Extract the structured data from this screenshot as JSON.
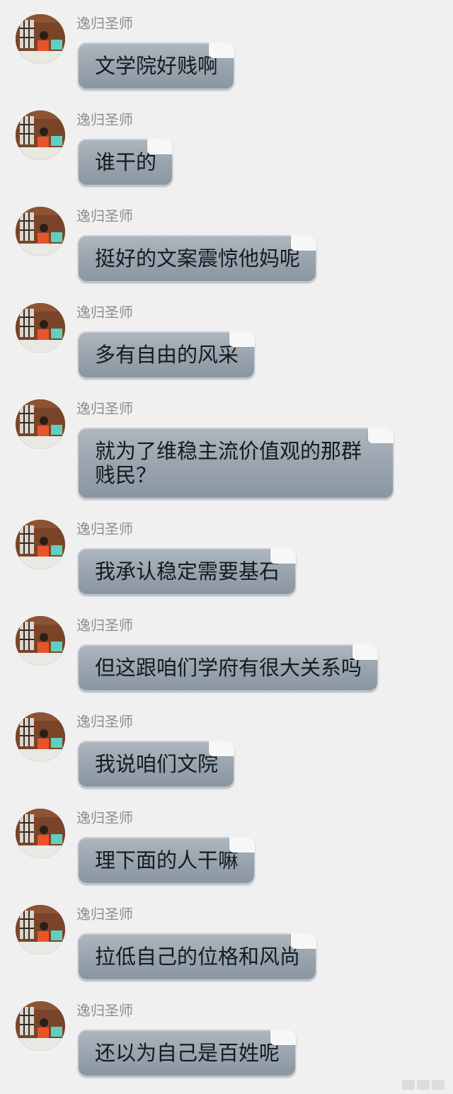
{
  "chat": {
    "messages": [
      {
        "sender": "逸归圣师",
        "text": "文学院好贱啊"
      },
      {
        "sender": "逸归圣师",
        "text": "谁干的"
      },
      {
        "sender": "逸归圣师",
        "text": "挺好的文案震惊他妈呢"
      },
      {
        "sender": "逸归圣师",
        "text": "多有自由的风采"
      },
      {
        "sender": "逸归圣师",
        "text": "就为了维稳主流价值观的那群贱民？"
      },
      {
        "sender": "逸归圣师",
        "text": "我承认稳定需要基石"
      },
      {
        "sender": "逸归圣师",
        "text": "但这跟咱们学府有很大关系吗"
      },
      {
        "sender": "逸归圣师",
        "text": "我说咱们文院"
      },
      {
        "sender": "逸归圣师",
        "text": "理下面的人干嘛"
      },
      {
        "sender": "逸归圣师",
        "text": "拉低自己的位格和风尚"
      },
      {
        "sender": "逸归圣师",
        "text": "还以为自己是百姓呢"
      }
    ]
  }
}
